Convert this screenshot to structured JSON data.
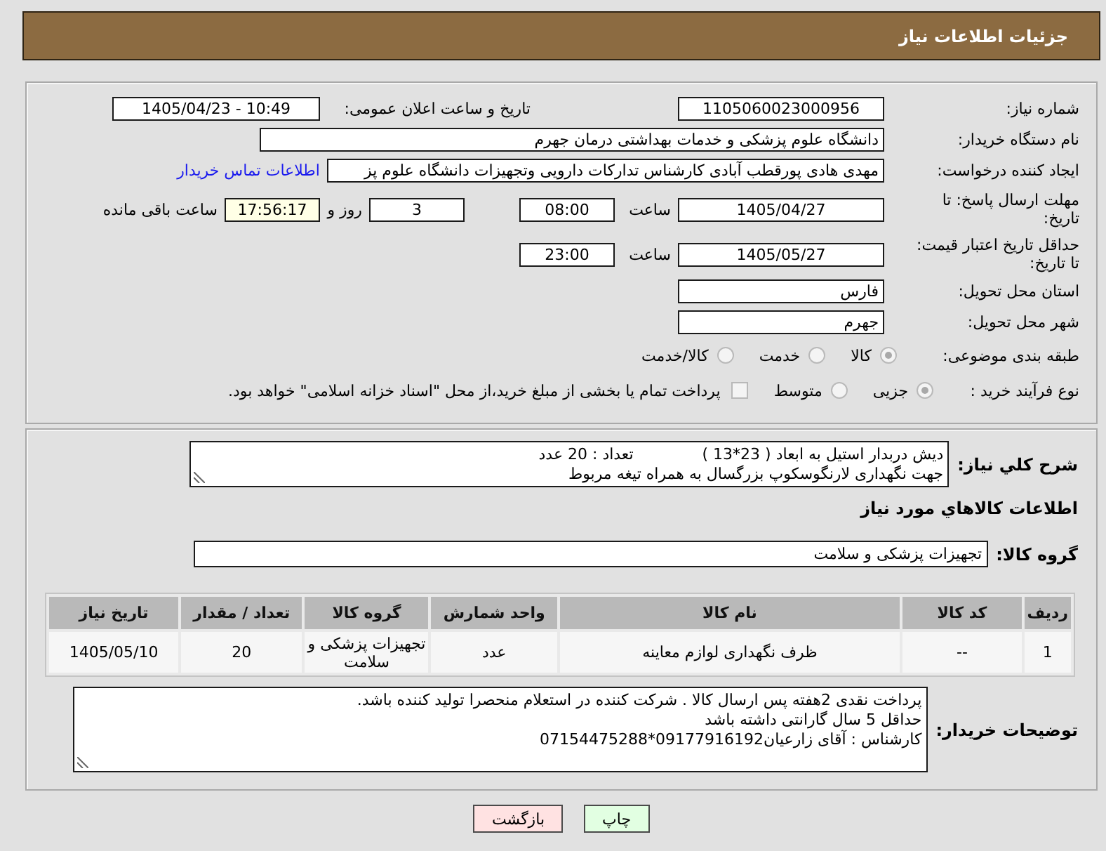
{
  "header": {
    "title": "جزئیات اطلاعات نیاز"
  },
  "details": {
    "need_number": {
      "label": "شماره نیاز:",
      "value": "1105060023000956"
    },
    "announce_datetime": {
      "label": "تاریخ و ساعت اعلان عمومی:",
      "value": "1405/04/23 - 10:49"
    },
    "buyer_org": {
      "label": "نام دستگاه خریدار:",
      "value": "دانشگاه علوم پزشکی و خدمات بهداشتی  درمان جهرم"
    },
    "requester": {
      "label": "ایجاد کننده درخواست:",
      "value": "مهدی هادی پورقطب آبادی کارشناس تدارکات دارویی وتجهیزات دانشگاه علوم پز",
      "link": "اطلاعات تماس خریدار"
    },
    "response_deadline": {
      "label": "مهلت ارسال پاسخ: تا تاریخ:",
      "date": "1405/04/27",
      "time_label": "ساعت",
      "time": "08:00",
      "days": "3",
      "days_label": "روز و",
      "remaining": "17:56:17",
      "remaining_label": "ساعت باقی مانده"
    },
    "price_validity": {
      "label": "حداقل تاریخ اعتبار قیمت: تا تاریخ:",
      "date": "1405/05/27",
      "time_label": "ساعت",
      "time": "23:00"
    },
    "province": {
      "label": "استان محل تحویل:",
      "value": "فارس"
    },
    "city": {
      "label": "شهر محل تحویل:",
      "value": "جهرم"
    },
    "category": {
      "label": "طبقه بندی موضوعی:",
      "options": [
        {
          "label": "کالا",
          "selected": true
        },
        {
          "label": "خدمت",
          "selected": false
        },
        {
          "label": "کالا/خدمت",
          "selected": false
        }
      ]
    },
    "purchase_type": {
      "label": "نوع فرآیند خرید :",
      "options": [
        {
          "label": "جزیی",
          "selected": true
        },
        {
          "label": "متوسط",
          "selected": false
        }
      ],
      "treasury_payment": {
        "label": "پرداخت تمام یا بخشی از مبلغ خرید،از محل \"اسناد خزانه اسلامی\" خواهد بود.",
        "checked": false
      }
    }
  },
  "need": {
    "description": {
      "label": "شرح کلي نیاز:",
      "lines": [
        "دیش دربدار استیل به ابعاد ( 23*13 )              تعداد : 20 عدد",
        "جهت نگهداری لارنگوسکوپ بزرگسال به همراه تیغه مربوط"
      ]
    },
    "items_title": "اطلاعات كالاهاي مورد نياز",
    "goods_group": {
      "label": "گروه کالا:",
      "value": "تجهیزات پزشکی و سلامت"
    },
    "table": {
      "columns": [
        "ردیف",
        "کد کالا",
        "نام کالا",
        "واحد شمارش",
        "گروه کالا",
        "تعداد / مقدار",
        "تاریخ نیاز"
      ],
      "rows": [
        [
          "1",
          "--",
          "ظرف نگهداری لوازم معاینه",
          "عدد",
          "تجهیزات پزشکی و سلامت",
          "20",
          "1405/05/10"
        ]
      ]
    },
    "buyer_notes": {
      "label": "توضیحات خریدار:",
      "lines": [
        "پرداخت نقدی 2هفته پس ارسال کالا . شرکت کننده در استعلام منحصرا تولید کننده باشد.",
        "حداقل 5 سال گارانتی داشته باشد",
        "کارشناس : آقای زارعیان09177916192*07154475288"
      ]
    }
  },
  "buttons": [
    {
      "label": "چاپ",
      "kind": "print"
    },
    {
      "label": "بازگشت",
      "kind": "back"
    }
  ]
}
